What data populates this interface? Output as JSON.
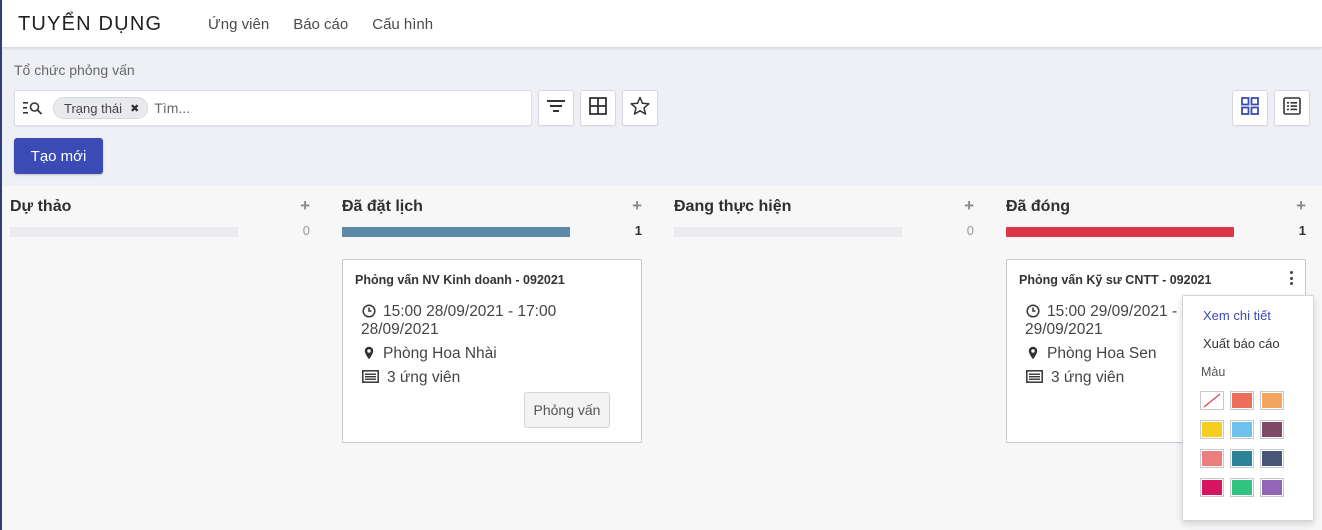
{
  "app": {
    "title": "TUYỂN DỤNG"
  },
  "menu": [
    "Ứng viên",
    "Báo cáo",
    "Cấu hình"
  ],
  "breadcrumb": "Tổ chức phỏng vấn",
  "search": {
    "facet": "Trạng thái",
    "placeholder": "Tìm..."
  },
  "toolbar": {
    "create_label": "Tạo mới"
  },
  "columns": [
    {
      "title": "Dự thảo",
      "count": "0",
      "progress": 0,
      "color": "#e9ebef"
    },
    {
      "title": "Đã đặt lịch",
      "count": "1",
      "progress": 1,
      "color": "#5b89a6"
    },
    {
      "title": "Đang thực hiện",
      "count": "0",
      "progress": 0,
      "color": "#e9ebef"
    },
    {
      "title": "Đã đóng",
      "count": "1",
      "progress": 1,
      "color": "#dc3545"
    }
  ],
  "cards": [
    {
      "title": "Phỏng vấn NV Kinh doanh - 092021",
      "time_line1": "15:00 28/09/2021 - 17:00",
      "time_line2": "28/09/2021",
      "location": "Phòng Hoa Nhài",
      "candidates": "3 ứng viên",
      "button": "Phỏng vấn"
    },
    {
      "title": "Phỏng vấn Kỹ sư CNTT - 092021",
      "time_line1": "15:00 29/09/2021 -",
      "time_line2": "29/09/2021",
      "location": "Phòng Hoa Sen",
      "candidates": "3 ứng viên"
    }
  ],
  "dropdown": {
    "view": "Xem chi tiết",
    "export": "Xuất báo cáo",
    "color_label": "Màu",
    "colors": [
      "none",
      "#eb6f5c",
      "#f2a55f",
      "#f7cd1f",
      "#6cc1ed",
      "#814968",
      "#eb7e7f",
      "#2c8397",
      "#475577",
      "#d6145f",
      "#30c381",
      "#9365b8"
    ]
  }
}
